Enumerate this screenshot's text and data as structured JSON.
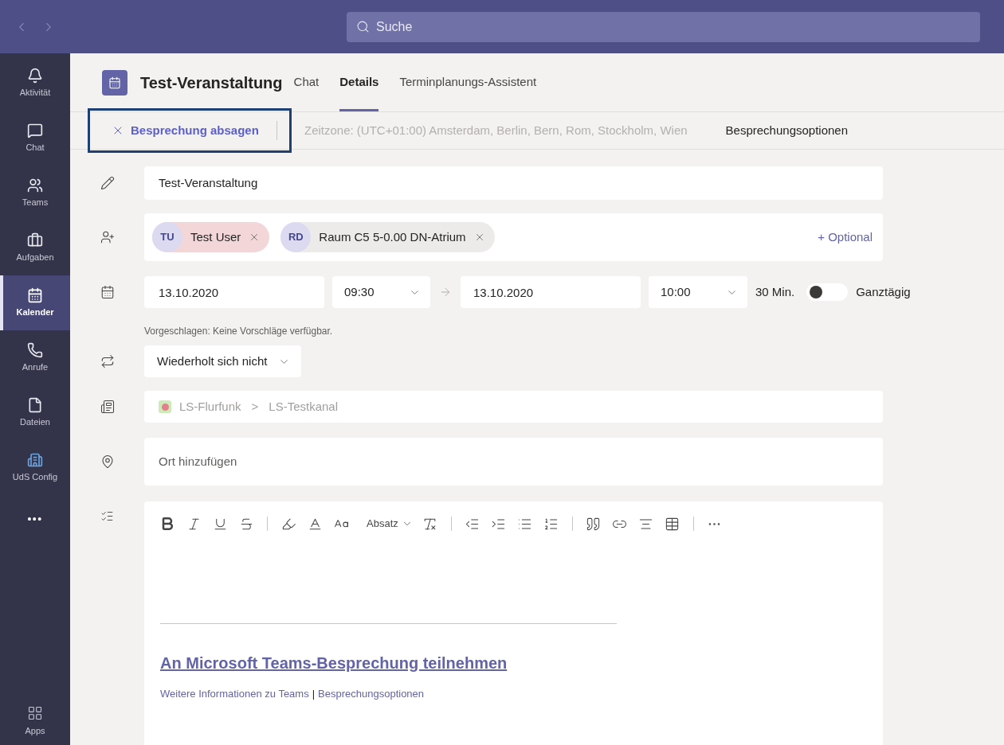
{
  "topbar": {
    "search_placeholder": "Suche"
  },
  "rail": {
    "items": [
      {
        "kind": "bell",
        "label": "Aktivität",
        "selected": false
      },
      {
        "kind": "chat",
        "label": "Chat",
        "selected": false
      },
      {
        "kind": "teams",
        "label": "Teams",
        "selected": false
      },
      {
        "kind": "tasks",
        "label": "Aufgaben",
        "selected": false
      },
      {
        "kind": "calendar",
        "label": "Kalender",
        "selected": true
      },
      {
        "kind": "phone",
        "label": "Anrufe",
        "selected": false
      },
      {
        "kind": "file",
        "label": "Dateien",
        "selected": false
      },
      {
        "kind": "building",
        "label": "UdS Config",
        "selected": false
      }
    ],
    "more": "•••",
    "apps": "Apps"
  },
  "header": {
    "title": "Test-Veranstaltung",
    "tabs": [
      {
        "label": "Chat",
        "selected": false
      },
      {
        "label": "Details",
        "selected": true
      },
      {
        "label": "Terminplanungs-Assistent",
        "selected": false
      }
    ]
  },
  "actions": {
    "cancel": {
      "label": "Besprechung absagen",
      "highlighted": true
    },
    "timezone": "Zeitzone: (UTC+01:00) Amsterdam, Berlin, Bern, Rom, Stockholm, Wien",
    "options": "Besprechungsoptionen"
  },
  "form": {
    "title": "Test-Veranstaltung",
    "attendees": [
      {
        "initials": "TU",
        "name": "Test User",
        "color": "#f3d6d8"
      },
      {
        "initials": "RD",
        "name": "Raum C5 5-0.00 DN-Atrium",
        "color": "#edebe9"
      }
    ],
    "optional": "+ Optional",
    "start_date": "13.10.2020",
    "start_time": "09:30",
    "end_date": "13.10.2020",
    "end_time": "10:00",
    "duration": "30 Min.",
    "all_day": {
      "label": "Ganztägig",
      "on": false
    },
    "suggestion": "Vorgeschlagen: Keine Vorschläge verfügbar.",
    "repeat": "Wiederholt sich nicht",
    "channel": {
      "team": "LS-Flurfunk",
      "separator": ">",
      "channel": "LS-Testkanal"
    },
    "location_placeholder": "Ort hinzufügen"
  },
  "editor": {
    "paragraph_style": "Absatz",
    "join_link": "An Microsoft Teams-Besprechung teilnehmen",
    "info_link": "Weitere Informationen zu Teams",
    "divider": "|",
    "options_link": "Besprechungsoptionen"
  }
}
